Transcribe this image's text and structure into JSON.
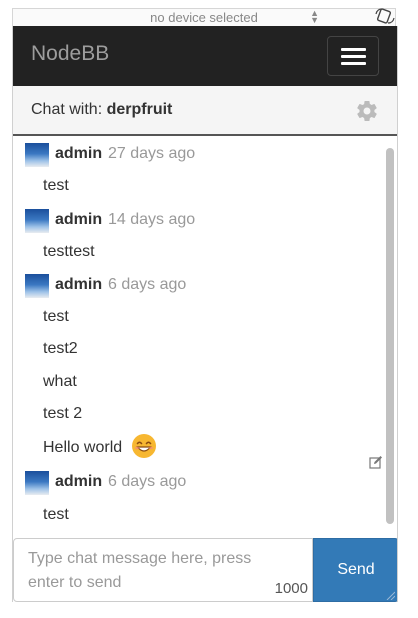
{
  "device_toolbar": {
    "device_label": "no device selected"
  },
  "navbar": {
    "brand": "NodeBB"
  },
  "chat": {
    "header_prefix": "Chat with:",
    "recipient": "derpfruit",
    "groups": [
      {
        "author": "admin",
        "timestamp": "27 days ago",
        "messages": [
          "test"
        ]
      },
      {
        "author": "admin",
        "timestamp": "14 days ago",
        "messages": [
          "testtest"
        ]
      },
      {
        "author": "admin",
        "timestamp": "6 days ago",
        "messages": [
          "test",
          "test2",
          "what",
          "test 2",
          "Hello world"
        ]
      },
      {
        "author": "admin",
        "timestamp": "6 days ago",
        "messages": [
          "test"
        ]
      }
    ]
  },
  "composer": {
    "placeholder": "Type chat message here, press enter to send",
    "char_limit": "1000",
    "send_label": "Send"
  },
  "icons": {
    "rotate": "rotate-device-icon",
    "menu": "hamburger-menu-icon",
    "settings": "gear-icon",
    "edit": "edit-icon",
    "emoji": "smiling-face-emoji"
  },
  "colors": {
    "navbar_bg": "#222222",
    "send_button": "#337ab7",
    "timestamp": "#999999"
  }
}
